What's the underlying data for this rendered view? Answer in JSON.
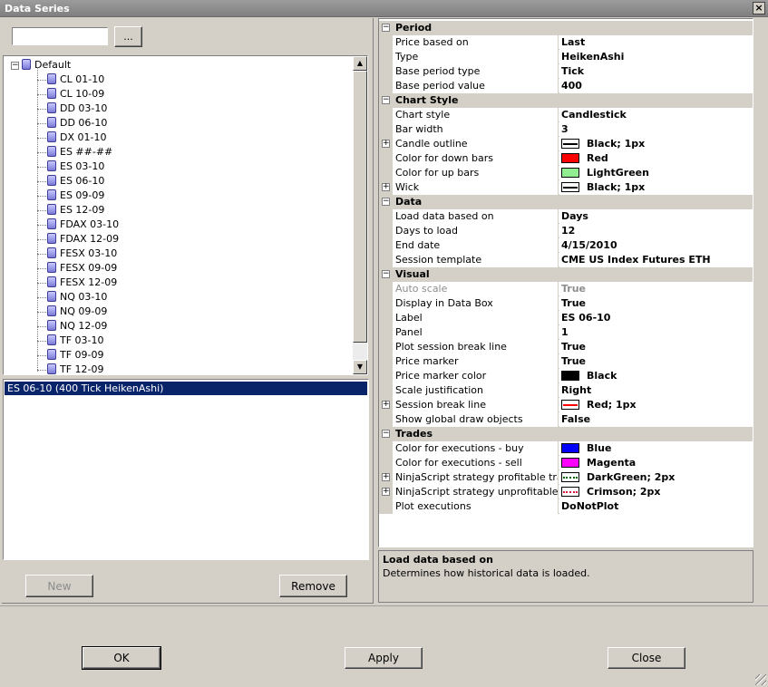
{
  "window": {
    "title": "Data Series",
    "close_glyph": "×"
  },
  "search": {
    "value": "",
    "browse_label": "..."
  },
  "tree": {
    "root_label": "Default",
    "items": [
      "CL 01-10",
      "CL 10-09",
      "DD 03-10",
      "DD 06-10",
      "DX 01-10",
      "ES ##-##",
      "ES 03-10",
      "ES 06-10",
      "ES 09-09",
      "ES 12-09",
      "FDAX 03-10",
      "FDAX 12-09",
      "FESX 03-10",
      "FESX 09-09",
      "FESX 12-09",
      "NQ 03-10",
      "NQ 09-09",
      "NQ 12-09",
      "TF 03-10",
      "TF 09-09",
      "TF 12-09"
    ]
  },
  "series": {
    "selected": "ES 06-10 (400 Tick HeikenAshi)"
  },
  "buttons": {
    "new": "New",
    "remove": "Remove",
    "ok": "OK",
    "apply": "Apply",
    "close": "Close"
  },
  "grid": {
    "period": {
      "label": "Period",
      "price_based_on": {
        "name": "Price based on",
        "value": "Last"
      },
      "type": {
        "name": "Type",
        "value": "HeikenAshi"
      },
      "base_period_type": {
        "name": "Base period type",
        "value": "Tick"
      },
      "base_period_value": {
        "name": "Base period value",
        "value": "400"
      }
    },
    "chart_style": {
      "label": "Chart Style",
      "chart_style": {
        "name": "Chart style",
        "value": "Candlestick"
      },
      "bar_width": {
        "name": "Bar width",
        "value": "3"
      },
      "candle_outline": {
        "name": "Candle outline",
        "value": "Black; 1px",
        "color": "#000000"
      },
      "down_bars": {
        "name": "Color for down bars",
        "value": "Red",
        "color": "#ff0000"
      },
      "up_bars": {
        "name": "Color for up bars",
        "value": "LightGreen",
        "color": "#90ee90"
      },
      "wick": {
        "name": "Wick",
        "value": "Black; 1px",
        "color": "#000000"
      }
    },
    "data": {
      "label": "Data",
      "load_based_on": {
        "name": "Load data based on",
        "value": "Days"
      },
      "days_to_load": {
        "name": "Days to load",
        "value": "12"
      },
      "end_date": {
        "name": "End date",
        "value": "4/15/2010"
      },
      "session_template": {
        "name": "Session template",
        "value": "CME US Index Futures ETH"
      }
    },
    "visual": {
      "label": "Visual",
      "auto_scale": {
        "name": "Auto scale",
        "value": "True"
      },
      "display_in_data_box": {
        "name": "Display in Data Box",
        "value": "True"
      },
      "label_row": {
        "name": "Label",
        "value": "ES 06-10"
      },
      "panel": {
        "name": "Panel",
        "value": "1"
      },
      "plot_session_break": {
        "name": "Plot session break line",
        "value": "True"
      },
      "price_marker": {
        "name": "Price marker",
        "value": "True"
      },
      "price_marker_color": {
        "name": "Price marker color",
        "value": "Black",
        "color": "#000000"
      },
      "scale_justification": {
        "name": "Scale justification",
        "value": "Right"
      },
      "session_break_line": {
        "name": "Session break line",
        "value": "Red; 1px",
        "color": "#ff0000"
      },
      "show_global_draw": {
        "name": "Show global draw objects",
        "value": "False"
      }
    },
    "trades": {
      "label": "Trades",
      "exec_buy": {
        "name": "Color for executions - buy",
        "value": "Blue",
        "color": "#0000ff"
      },
      "exec_sell": {
        "name": "Color for executions - sell",
        "value": "Magenta",
        "color": "#ff00ff"
      },
      "profitable": {
        "name": "NinjaScript strategy profitable trade",
        "value": "DarkGreen; 2px",
        "color": "#006400"
      },
      "unprofitable": {
        "name": "NinjaScript strategy unprofitable trac",
        "value": "Crimson; 2px",
        "color": "#dc143c"
      },
      "plot_executions": {
        "name": "Plot executions",
        "value": "DoNotPlot"
      }
    }
  },
  "description": {
    "title": "Load data based on",
    "text": "Determines how historical data is loaded."
  }
}
